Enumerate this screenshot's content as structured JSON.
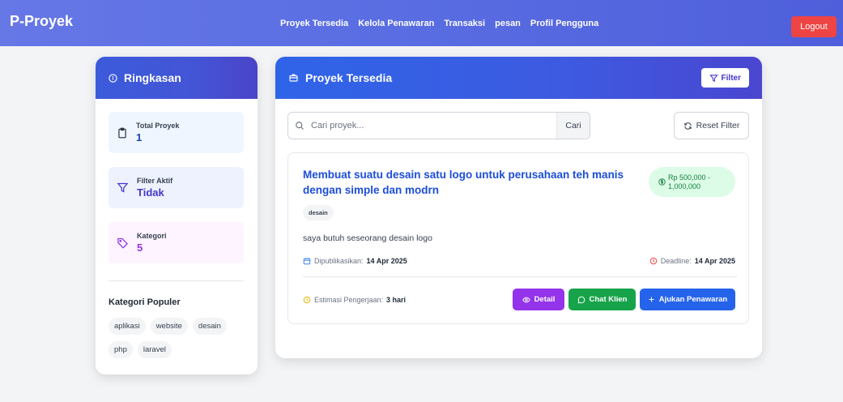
{
  "navbar": {
    "brand": "P-Proyek",
    "links": [
      "Proyek Tersedia",
      "Kelola Penawaran",
      "Transaksi",
      "pesan",
      "Profil Pengguna"
    ],
    "logout_label": "Logout"
  },
  "sidebar": {
    "title": "Ringkasan",
    "stats": [
      {
        "label": "Total Proyek",
        "value": "1",
        "icon": "clipboard-icon"
      },
      {
        "label": "Filter Aktif",
        "value": "Tidak",
        "icon": "filter-icon"
      },
      {
        "label": "Kategori",
        "value": "5",
        "icon": "tag-icon"
      }
    ],
    "popular_title": "Kategori Populer",
    "popular_categories": [
      "aplikasi",
      "website",
      "desain",
      "php",
      "laravel"
    ]
  },
  "main": {
    "title": "Proyek Tersedia",
    "filter_label": "Filter",
    "search": {
      "placeholder": "Cari proyek...",
      "value": "",
      "button_label": "Cari"
    },
    "reset_label": "Reset Filter",
    "project": {
      "title": "Membuat suatu desain satu logo untuk perusahaan teh manis dengan simple dan modrn",
      "price_line1": "Rp 500,000 -",
      "price_line2": "1,000,000",
      "tag": "desain",
      "description": "saya butuh seseorang desain logo",
      "published_label": "Dipublikasikan:",
      "published_date": "14 Apr 2025",
      "deadline_label": "Deadline:",
      "deadline_date": "14 Apr 2025",
      "estimate_label": "Estimasi Pengerjaan:",
      "estimate_value": "3 hari",
      "detail_label": "Detail",
      "chat_label": "Chat Klien",
      "ajukan_label": "Ajukan Penawaran"
    }
  },
  "colors": {
    "navbar": "#5b6fe3",
    "logout": "#ef4444",
    "header": "#3d5ae0",
    "title_link": "#1d4ed8",
    "detail": "#9333ea",
    "chat": "#16a34a",
    "ajukan": "#2563eb"
  }
}
